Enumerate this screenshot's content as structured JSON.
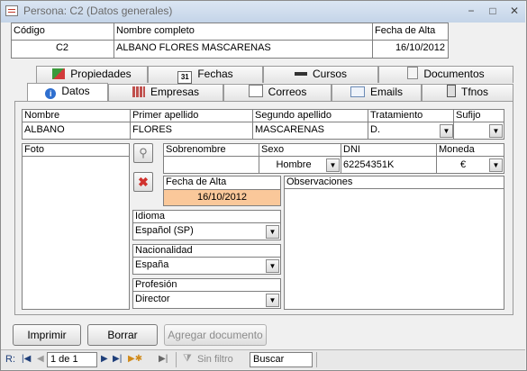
{
  "window": {
    "title": "Persona: C2 (Datos generales)",
    "minimize": "−",
    "maximize": "□",
    "close": "✕"
  },
  "header": {
    "codigo_label": "Código",
    "codigo_value": "C2",
    "nombre_label": "Nombre completo",
    "nombre_value": "ALBANO FLORES MASCARENAS",
    "fecha_label": "Fecha de Alta",
    "fecha_value": "16/10/2012"
  },
  "tabs_top": [
    {
      "label": "Propiedades",
      "icon": "properties-icon"
    },
    {
      "label": "Fechas",
      "icon": "calendar-icon",
      "icon_text": "31"
    },
    {
      "label": "Cursos",
      "icon": "graduation-cap-icon"
    },
    {
      "label": "Documentos",
      "icon": "document-icon"
    }
  ],
  "tabs_bottom": [
    {
      "label": "Datos",
      "icon": "info-icon",
      "active": true
    },
    {
      "label": "Empresas",
      "icon": "building-icon"
    },
    {
      "label": "Correos",
      "icon": "mail-icon"
    },
    {
      "label": "Emails",
      "icon": "envelope-icon"
    },
    {
      "label": "Tfnos",
      "icon": "phone-icon"
    }
  ],
  "person": {
    "nombre_label": "Nombre",
    "nombre": "ALBANO",
    "apellido1_label": "Primer apellido",
    "apellido1": "FLORES",
    "apellido2_label": "Segundo apellido",
    "apellido2": "MASCARENAS",
    "tratamiento_label": "Tratamiento",
    "tratamiento": "D.",
    "sufijo_label": "Sufijo",
    "sufijo": ""
  },
  "foto_label": "Foto",
  "details": {
    "sobrenombre_label": "Sobrenombre",
    "sobrenombre": "",
    "sexo_label": "Sexo",
    "sexo": "Hombre",
    "dni_label": "DNI",
    "dni": "62254351K",
    "moneda_label": "Moneda",
    "moneda": "€",
    "fecha_alta_label": "Fecha de Alta",
    "fecha_alta": "16/10/2012",
    "observaciones_label": "Observaciones",
    "observaciones": "",
    "idioma_label": "Idioma",
    "idioma": "Español (SP)",
    "nacionalidad_label": "Nacionalidad",
    "nacionalidad": "España",
    "profesion_label": "Profesión",
    "profesion": "Director"
  },
  "buttons": {
    "imprimir": "Imprimir",
    "borrar": "Borrar",
    "agregar": "Agregar documento"
  },
  "statusbar": {
    "record_label": "R:",
    "record_value": "1 de 1",
    "filter": "Sin filtro",
    "search": "Buscar"
  },
  "colors": {
    "highlight_field": "#fac89a",
    "accent": "#2f5c9f"
  }
}
